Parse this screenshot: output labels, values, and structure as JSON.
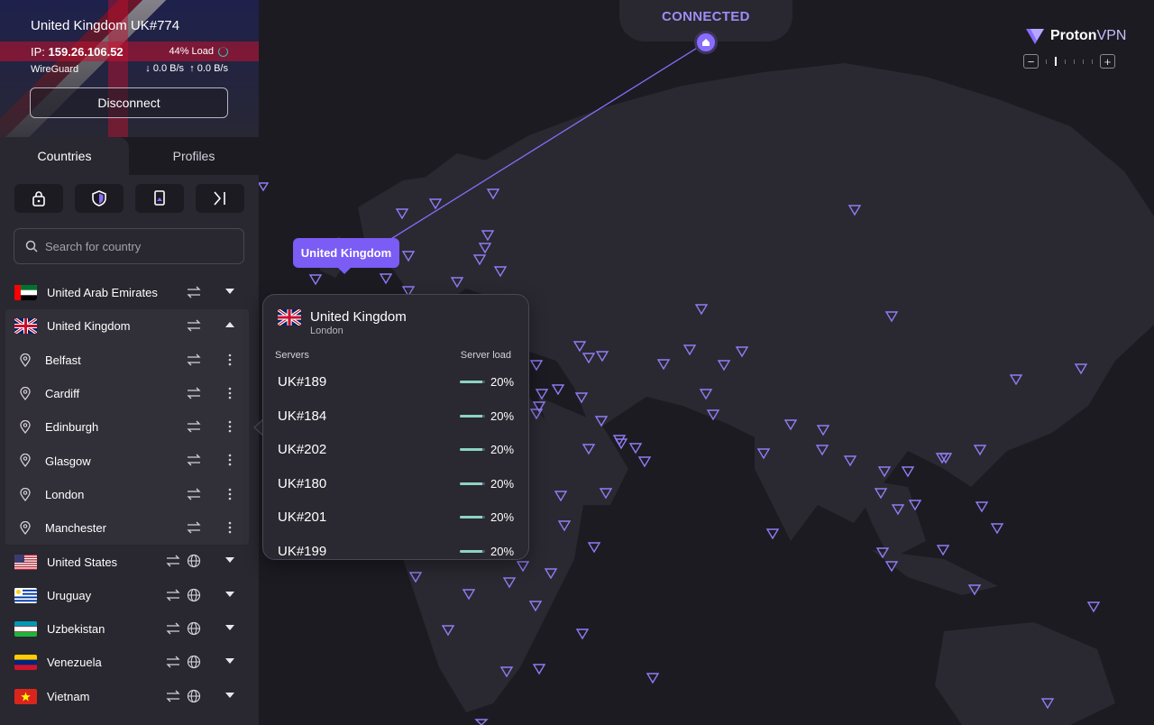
{
  "connection": {
    "title": "United Kingdom UK#774",
    "ip_label": "IP:",
    "ip": "159.26.106.52",
    "load": "44% Load",
    "protocol": "WireGuard",
    "download": "0.0 B/s",
    "upload": "0.0 B/s",
    "disconnect_label": "Disconnect"
  },
  "tabs": [
    {
      "label": "Countries"
    },
    {
      "label": "Profiles"
    }
  ],
  "search": {
    "placeholder": "Search for country"
  },
  "countries_before": [
    {
      "name": "United Arab Emirates",
      "flag": "ae"
    }
  ],
  "expanded_country": {
    "name": "United Kingdom",
    "cities": [
      "Belfast",
      "Cardiff",
      "Edinburgh",
      "Glasgow",
      "London",
      "Manchester"
    ]
  },
  "countries_after": [
    {
      "name": "United States",
      "flag": "us"
    },
    {
      "name": "Uruguay",
      "flag": "uy"
    },
    {
      "name": "Uzbekistan",
      "flag": "uz"
    },
    {
      "name": "Venezuela",
      "flag": "ve"
    },
    {
      "name": "Vietnam",
      "flag": "vn"
    }
  ],
  "map": {
    "status": "CONNECTED",
    "brand_proton": "Proton",
    "brand_vpn": "VPN",
    "tooltip": "United Kingdom"
  },
  "popup": {
    "country": "United Kingdom",
    "city": "London",
    "col_servers": "Servers",
    "col_load": "Server load",
    "servers": [
      {
        "name": "UK#189",
        "load": "20%",
        "load_value": 0.2
      },
      {
        "name": "UK#184",
        "load": "20%",
        "load_value": 0.2
      },
      {
        "name": "UK#202",
        "load": "20%",
        "load_value": 0.2
      },
      {
        "name": "UK#180",
        "load": "20%",
        "load_value": 0.2
      },
      {
        "name": "UK#201",
        "load": "20%",
        "load_value": 0.2
      },
      {
        "name": "UK#199",
        "load": "20%",
        "load_value": 0.2
      }
    ]
  },
  "colors": {
    "accent": "#7b5cf5",
    "connected": "#9e8cf7",
    "load_ring": "#2ec4b6"
  }
}
